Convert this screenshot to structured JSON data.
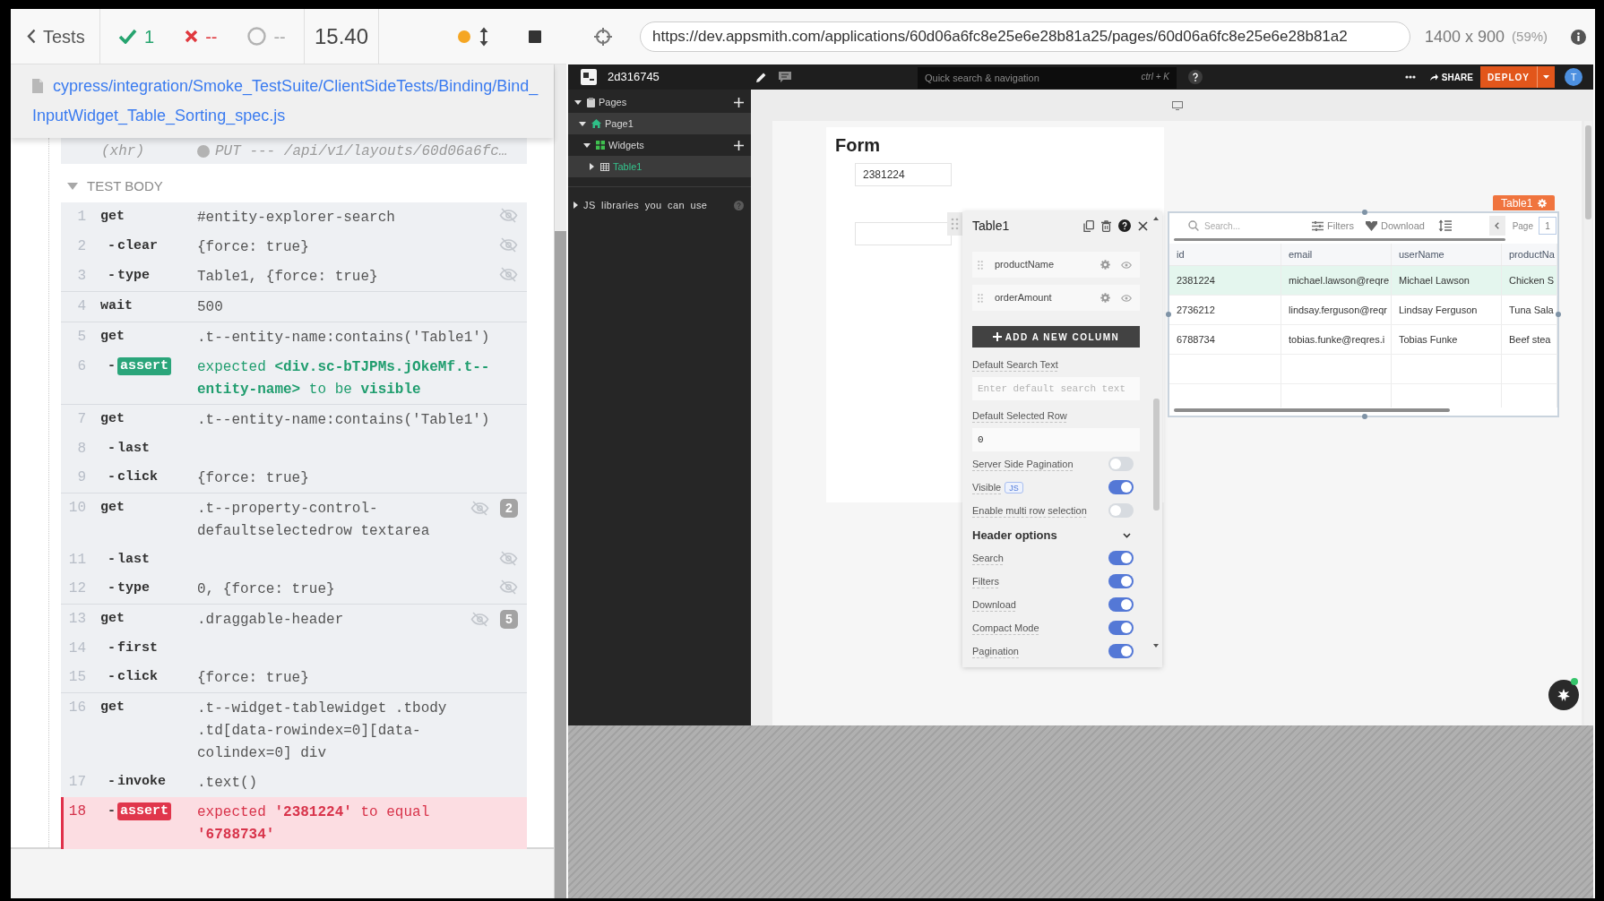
{
  "runner_header": {
    "back_label": "Tests",
    "stats": [
      {
        "kind": "passed",
        "count": "1"
      },
      {
        "kind": "failed",
        "count": "--"
      },
      {
        "kind": "pending",
        "count": "--"
      }
    ],
    "duration": "15.40"
  },
  "spec": {
    "path": "cypress/integration/Smoke_TestSuite/ClientSideTests/Binding/Bind_InputWidget_Table_Sorting_spec.js"
  },
  "command_log": {
    "hook_entry": {
      "label": "(xhr)",
      "message": "PUT --- /api/v1/layouts/60d06a6fc…"
    },
    "section": {
      "title": "TEST BODY",
      "expanded": true
    },
    "groups": [
      {
        "commands": [
          {
            "number": "1",
            "kind": "command",
            "name": "get",
            "message": "#entity-explorer-search",
            "hidden": true,
            "failed": false
          },
          {
            "number": "2",
            "prefix": "-",
            "kind": "command",
            "name": "clear",
            "message": "{force: true}",
            "hidden": true,
            "failed": false
          },
          {
            "number": "3",
            "prefix": "-",
            "kind": "command",
            "name": "type",
            "message": "Table1, {force: true}",
            "hidden": true,
            "failed": false
          }
        ]
      },
      {
        "commands": [
          {
            "number": "4",
            "kind": "command",
            "name": "wait",
            "message": "500",
            "hidden": false,
            "failed": false
          }
        ]
      },
      {
        "commands": [
          {
            "number": "5",
            "kind": "command",
            "name": "get",
            "message": ".t--entity-name:contains('Table1')",
            "hidden": false,
            "failed": false
          },
          {
            "number": "6",
            "prefix": "-",
            "kind": "assert",
            "name": "assert",
            "message": "expected **<div.sc-bTJPMs.jOkeMf.t--entity-name>** to be **visible**",
            "hidden": false,
            "failed": false
          }
        ]
      },
      {
        "commands": [
          {
            "number": "7",
            "kind": "command",
            "name": "get",
            "message": ".t--entity-name:contains('Table1')",
            "hidden": false,
            "failed": false
          },
          {
            "number": "8",
            "prefix": "-",
            "kind": "command",
            "name": "last",
            "hidden": false,
            "failed": false
          },
          {
            "number": "9",
            "prefix": "-",
            "kind": "command",
            "name": "click",
            "message": "{force: true}",
            "hidden": false,
            "failed": false
          }
        ]
      },
      {
        "commands": [
          {
            "number": "10",
            "kind": "command",
            "name": "get",
            "message": ".t--property-control-defaultselectedrow textarea",
            "hidden": true,
            "count": "2",
            "failed": false
          },
          {
            "number": "11",
            "prefix": "-",
            "kind": "command",
            "name": "last",
            "hidden": true,
            "failed": false
          },
          {
            "number": "12",
            "prefix": "-",
            "kind": "command",
            "name": "type",
            "message": "0, {force: true}",
            "hidden": true,
            "failed": false
          }
        ]
      },
      {
        "commands": [
          {
            "number": "13",
            "kind": "command",
            "name": "get",
            "message": ".draggable-header",
            "hidden": true,
            "count": "5",
            "failed": false
          },
          {
            "number": "14",
            "prefix": "-",
            "kind": "command",
            "name": "first",
            "hidden": false,
            "failed": false
          },
          {
            "number": "15",
            "prefix": "-",
            "kind": "command",
            "name": "click",
            "message": "{force: true}",
            "hidden": false,
            "failed": false
          }
        ]
      },
      {
        "commands": [
          {
            "number": "16",
            "kind": "command",
            "name": "get",
            "message": ".t--widget-tablewidget .tbody .td[data-rowindex=0][data-colindex=0] div",
            "hidden": false,
            "failed": false
          },
          {
            "number": "17",
            "prefix": "-",
            "kind": "command",
            "name": "invoke",
            "message": ".text()",
            "hidden": false,
            "failed": false
          },
          {
            "number": "18",
            "prefix": "-",
            "kind": "assert",
            "name": "assert",
            "message": "expected **'2381224'** to equal **'6788734'**",
            "hidden": false,
            "failed": true
          }
        ]
      }
    ]
  },
  "aut_bar": {
    "url": "https://dev.appsmith.com/applications/60d06a6fc8e25e6e28b81a25/pages/60d06a6fc8e25e6e28b81a2",
    "viewport": "1400 x 900",
    "scale": "(59%)"
  },
  "app_header": {
    "app_name": "2d316745",
    "search": {
      "placeholder": "Quick search & navigation",
      "shortcut": "ctrl + K"
    },
    "share_label": "SHARE",
    "deploy_label": "DEPLOY",
    "avatar": "T"
  },
  "explorer": {
    "items": [
      {
        "kind": "pages",
        "label": "Pages",
        "expanded": true,
        "selected": false,
        "addable": true,
        "children": [
          {
            "kind": "page",
            "label": "Page1",
            "expanded": true,
            "selected": true,
            "addable": false,
            "children": [
              {
                "kind": "widgets",
                "label": "Widgets",
                "expanded": true,
                "selected": false,
                "addable": true,
                "children": [
                  {
                    "kind": "table",
                    "label": "Table1",
                    "expanded": false,
                    "selected": true,
                    "addable": false
                  }
                ]
              }
            ]
          }
        ]
      }
    ],
    "js_libraries": {
      "label": "JS libraries you can use",
      "expanded": false
    }
  },
  "canvas": {
    "form": {
      "title": "Form",
      "inputs": [
        {
          "kind": "text",
          "value": "2381224"
        },
        {
          "kind": "text"
        }
      ]
    },
    "property_pane": {
      "title": "Table1",
      "columns": [
        {
          "name": "productName",
          "visible": true
        },
        {
          "name": "orderAmount",
          "visible": true
        }
      ],
      "add_column_label": "ADD A NEW COLUMN",
      "properties": [
        {
          "kind": "input",
          "label": "Default Search Text",
          "placeholder": "Enter default search text"
        },
        {
          "kind": "input",
          "label": "Default Selected Row",
          "value": "0"
        },
        {
          "kind": "switch",
          "label": "Server Side Pagination",
          "on": false
        },
        {
          "kind": "switch",
          "label": "Visible",
          "tag": "JS",
          "on": true
        },
        {
          "kind": "switch",
          "label": "Enable multi row selection",
          "on": false
        },
        {
          "kind": "section",
          "label": "Header options",
          "expanded": true
        },
        {
          "kind": "switch",
          "label": "Search",
          "on": true
        },
        {
          "kind": "switch",
          "label": "Filters",
          "on": true
        },
        {
          "kind": "switch",
          "label": "Download",
          "on": true
        },
        {
          "kind": "switch",
          "label": "Compact Mode",
          "on": true
        },
        {
          "kind": "switch",
          "label": "Pagination",
          "on": true
        }
      ]
    },
    "table": {
      "tag": "Table1",
      "search": {
        "placeholder": "Search..."
      },
      "actions": [
        {
          "kind": "filter",
          "label": "Filters"
        },
        {
          "kind": "download",
          "label": "Download"
        }
      ],
      "page_label": "Page",
      "page": "1",
      "columns": [
        "id",
        "email",
        "userName",
        "productNa"
      ],
      "rows": [
        {
          "selected": true,
          "cells": [
            "2381224",
            "michael.lawson@reqre",
            "Michael Lawson",
            "Chicken S"
          ]
        },
        {
          "selected": false,
          "cells": [
            "2736212",
            "lindsay.ferguson@reqr",
            "Lindsay Ferguson",
            "Tuna Sala"
          ]
        },
        {
          "selected": false,
          "cells": [
            "6788734",
            "tobias.funke@reqres.i",
            "Tobias Funke",
            "Beef stea"
          ]
        }
      ]
    }
  }
}
